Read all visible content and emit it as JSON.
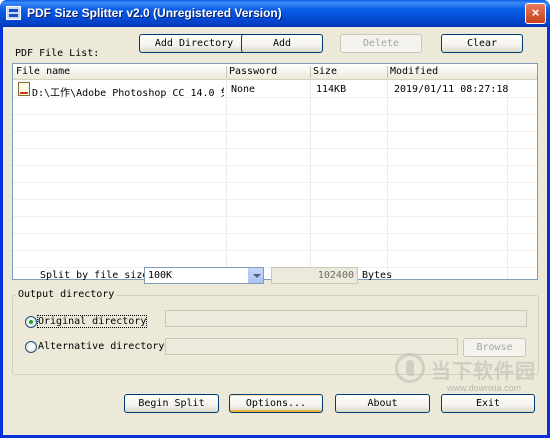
{
  "window": {
    "title": "PDF Size Splitter v2.0 (Unregistered Version)",
    "close_glyph": "×"
  },
  "toolbar": {
    "add_directory": "Add Directory",
    "add": "Add",
    "delete": "Delete",
    "clear": "Clear"
  },
  "file_list": {
    "label": "PDF File List:",
    "columns": [
      "File name",
      "Password",
      "Size",
      "Modified"
    ],
    "rows": [
      {
        "icon": "pdf-file-icon",
        "file_name": "D:\\工作\\Adobe Photoshop CC 14.0 免...",
        "password": "None",
        "size": "114KB",
        "modified": "2019/01/11 08:27:18"
      }
    ]
  },
  "split": {
    "label": "Split by file size:",
    "selected_option": "100K",
    "bytes_value": "102400",
    "bytes_unit": "Bytes"
  },
  "output": {
    "group_label": "Output directory",
    "original_label": "Original directory",
    "original_selected": true,
    "original_path": "",
    "alternative_label": "Alternative directory",
    "alternative_path": "",
    "browse": "Browse"
  },
  "footer": {
    "begin_split": "Begin Split",
    "options": "Options...",
    "about": "About",
    "exit": "Exit"
  },
  "watermark": {
    "text": "当下软件园",
    "url": "www.downxia.com"
  },
  "colors": {
    "title_bar": "#0a5ee8",
    "dialog_bg": "#ece9d8",
    "accent_border": "#003c74"
  }
}
